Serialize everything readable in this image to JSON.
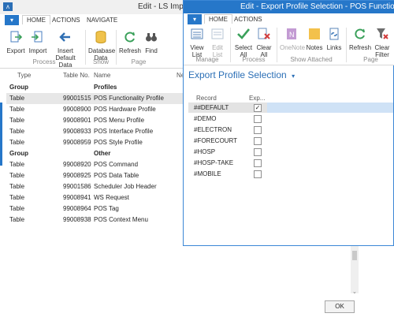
{
  "back_window": {
    "title": "Edit - LS Impo",
    "tabs": [
      "HOME",
      "ACTIONS",
      "NAVIGATE"
    ],
    "ribbon": {
      "process": {
        "label": "Process",
        "buttons": [
          "Export",
          "Import",
          "Insert Default Data"
        ]
      },
      "show": {
        "label": "Show",
        "buttons": [
          "Database Data"
        ]
      },
      "page": {
        "label": "Page",
        "buttons": [
          "Refresh",
          "Find"
        ]
      }
    },
    "table_headers": [
      "Type",
      "Table No.",
      "Name",
      "Ne"
    ],
    "rows": [
      {
        "type": "Group",
        "no": "",
        "name": "Profiles",
        "group": true
      },
      {
        "type": "Table",
        "no": "99001515",
        "name": "POS Functionality Profile",
        "selected": true
      },
      {
        "type": "Table",
        "no": "99008900",
        "name": "POS Hardware Profile"
      },
      {
        "type": "Table",
        "no": "99008901",
        "name": "POS Menu Profile"
      },
      {
        "type": "Table",
        "no": "99008933",
        "name": "POS Interface Profile"
      },
      {
        "type": "Table",
        "no": "99008959",
        "name": "POS Style Profile"
      },
      {
        "type": "Group",
        "no": "",
        "name": "Other",
        "group": true
      },
      {
        "type": "Table",
        "no": "99008920",
        "name": "POS Command"
      },
      {
        "type": "Table",
        "no": "99008925",
        "name": "POS Data Table"
      },
      {
        "type": "Table",
        "no": "99001586",
        "name": "Scheduler Job Header"
      },
      {
        "type": "Table",
        "no": "99008941",
        "name": "WS Request"
      },
      {
        "type": "Table",
        "no": "99008964",
        "name": "POS Tag"
      },
      {
        "type": "Table",
        "no": "99008938",
        "name": "POS Context Menu"
      }
    ],
    "ok_label": "OK"
  },
  "dialog": {
    "title": "Edit - Export Profile Selection - POS Functio",
    "tabs": [
      "HOME",
      "ACTIONS"
    ],
    "ribbon": {
      "manage": {
        "label": "Manage",
        "buttons": [
          "View List",
          "Edit List"
        ]
      },
      "process": {
        "label": "Process",
        "buttons": [
          "Select All",
          "Clear All"
        ]
      },
      "show_attached": {
        "label": "Show Attached",
        "buttons": [
          "OneNote",
          "Notes",
          "Links"
        ]
      },
      "page": {
        "label": "Page",
        "buttons": [
          "Refresh",
          "Clear Filter"
        ]
      }
    },
    "page_title": "Export Profile Selection",
    "page_title_caret": "▾",
    "col_record": "Record",
    "col_export": "Exp...",
    "records": [
      {
        "name": "##DEFAULT",
        "checked": true,
        "selected": true
      },
      {
        "name": "#DEMO",
        "checked": false
      },
      {
        "name": "#ELECTRON",
        "checked": false
      },
      {
        "name": "#FORECOURT",
        "checked": false
      },
      {
        "name": "#HOSP",
        "checked": false
      },
      {
        "name": "#HOSP-TAKE",
        "checked": false
      },
      {
        "name": "#MOBILE",
        "checked": false
      }
    ]
  },
  "colors": {
    "accent": "#2677c9",
    "title_text": "#2b6fb6"
  }
}
